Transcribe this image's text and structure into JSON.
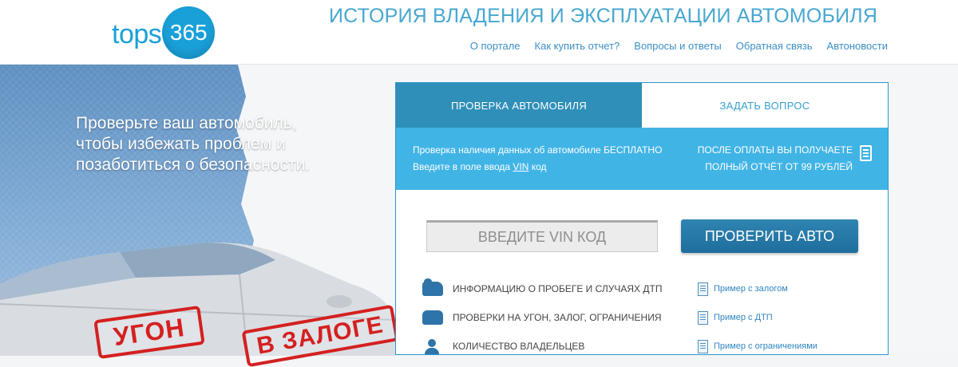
{
  "header": {
    "logo_text": "tops",
    "logo_number": "365",
    "title": "ИСТОРИЯ ВЛАДЕНИЯ И ЭКСПЛУАТАЦИИ АВТОМОБИЛЯ",
    "nav": [
      "О портале",
      "Как купить отчет?",
      "Вопросы и ответы",
      "Обратная связь",
      "Автоновости"
    ]
  },
  "hero": {
    "slogan_line1": "Проверьте ваш автомобиль,",
    "slogan_line2": "чтобы избежать проблем и",
    "slogan_line3": "позаботиться о безопасности.",
    "stamp_1": "УГОН",
    "stamp_2": "В ЗАЛОГЕ"
  },
  "panel": {
    "tabs": [
      "ПРОВЕРКА АВТОМОБИЛЯ",
      "ЗАДАТЬ ВОПРОС"
    ],
    "info_left_line1": "Проверка наличия данных об автомобиле БЕСПЛАТНО",
    "info_left_line2_a": "Введите в поле ввода ",
    "info_left_line2_vin": "VIN",
    "info_left_line2_b": " код",
    "info_right_line1": "ПОСЛЕ ОПЛАТЫ ВЫ ПОЛУЧАЕТЕ",
    "info_right_line2": "ПОЛНЫЙ ОТЧЁТ ОТ 99 РУБЛЕЙ",
    "vin_placeholder": "ВВЕДИТЕ VIN КОД",
    "check_button": "ПРОВЕРИТЬ АВТО",
    "features": [
      {
        "icon": "tow-truck-icon",
        "label": "ИНФОРМАЦИЮ О ПРОБЕГЕ И СЛУЧАЯХ ДТП"
      },
      {
        "icon": "car-check-icon",
        "label": "ПРОВЕРКИ НА УГОН, ЗАЛОГ, ОГРАНИЧЕНИЯ"
      },
      {
        "icon": "owners-icon",
        "label": "КОЛИЧЕСТВО ВЛАДЕЛЬЦЕВ"
      }
    ],
    "examples": [
      {
        "icon": "document-icon",
        "label": "Пример с залогом"
      },
      {
        "icon": "document-icon",
        "label": "Пример с ДТП"
      },
      {
        "icon": "document-icon",
        "label": "Пример с ограничениями"
      }
    ]
  },
  "colors": {
    "accent": "#1aa0d8",
    "tab_active": "#2f8fb8",
    "info_bar": "#41b4e6",
    "button": "#1f6e9d",
    "stamp": "#d42020"
  }
}
